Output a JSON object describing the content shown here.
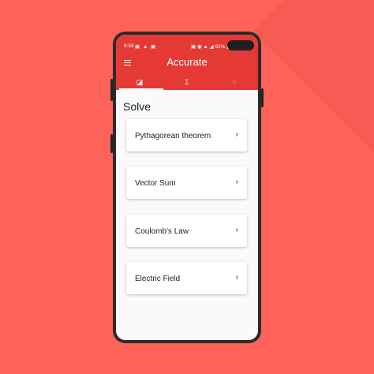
{
  "status_bar": {
    "time": "6:59",
    "left_icons": "▣ ▲ ▣ ··",
    "right_text": "▣ ◉ ▲ ◢ 92% ▮"
  },
  "app": {
    "title": "Accurate",
    "menu_icon": "hamburger-menu-icon"
  },
  "tabs": [
    {
      "icon": "calculator-icon",
      "glyph": "◪",
      "active": true
    },
    {
      "icon": "sigma-icon",
      "glyph": "Σ",
      "active": false
    },
    {
      "icon": "lightbulb-icon",
      "glyph": "♢",
      "active": false
    }
  ],
  "section": {
    "title": "Solve"
  },
  "items": [
    {
      "label": "Pythagorean theorem",
      "chevron": "›"
    },
    {
      "label": "Vector Sum",
      "chevron": "›"
    },
    {
      "label": "Coulomb's Law",
      "chevron": "›"
    },
    {
      "label": "Electric Field",
      "chevron": "›"
    }
  ],
  "colors": {
    "background": "#FF6259",
    "primary": "#E53935"
  }
}
